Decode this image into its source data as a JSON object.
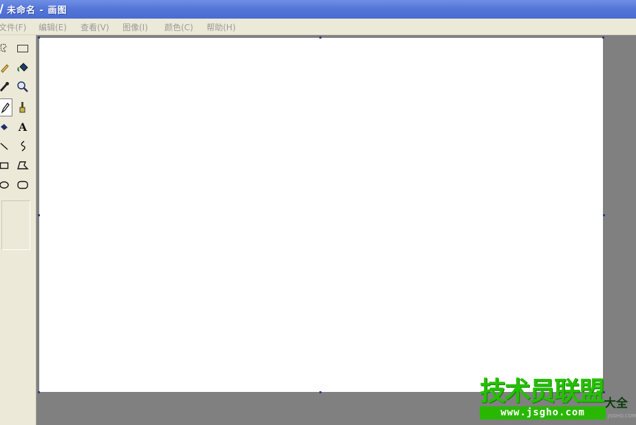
{
  "window": {
    "title": "未命名 - 画图"
  },
  "menu": {
    "items": [
      {
        "label": "文件(F)"
      },
      {
        "label": "编辑(E)"
      },
      {
        "label": "查看(V)"
      },
      {
        "label": "图像(I)"
      },
      {
        "label": "颜色(C)"
      },
      {
        "label": "帮助(H)"
      }
    ]
  },
  "tools": [
    {
      "icon": "free-form-select-icon"
    },
    {
      "icon": "rectangle-select-icon"
    },
    {
      "icon": "eraser-icon"
    },
    {
      "icon": "fill-bucket-icon"
    },
    {
      "icon": "color-picker-icon"
    },
    {
      "icon": "magnifier-icon"
    },
    {
      "icon": "pencil-icon",
      "selected": true
    },
    {
      "icon": "brush-icon"
    },
    {
      "icon": "airbrush-icon"
    },
    {
      "icon": "text-icon",
      "glyph": "A"
    },
    {
      "icon": "line-icon"
    },
    {
      "icon": "curve-icon"
    },
    {
      "icon": "rectangle-icon"
    },
    {
      "icon": "polygon-icon"
    },
    {
      "icon": "ellipse-icon"
    },
    {
      "icon": "rounded-rectangle-icon"
    }
  ],
  "watermark": {
    "main": "技术员联盟",
    "side": "大全",
    "url": "www.jsgho.com",
    "small": "JSGHO.COM"
  },
  "colors": {
    "titlebar": "#5577d8",
    "workspace": "#808080",
    "canvas": "#ffffff",
    "watermark_green": "#25c000"
  }
}
